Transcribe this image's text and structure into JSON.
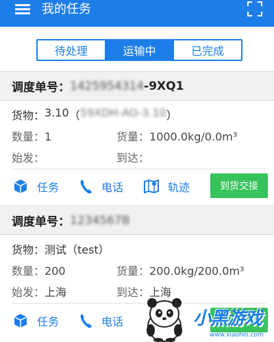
{
  "header": {
    "title": "我的任务",
    "menu_icon": "menu-icon",
    "scan_icon": "scan-icon"
  },
  "tabs": [
    {
      "label": "待处理",
      "active": false
    },
    {
      "label": "运输中",
      "active": true
    },
    {
      "label": "已完成",
      "active": false
    }
  ],
  "colors": {
    "primary": "#1d7ee8",
    "success": "#37c25b"
  },
  "cards": [
    {
      "order_label": "调度单号：",
      "order_number_masked": "1425954314",
      "order_number_suffix": "-9XQ1",
      "goods_label": "货物：",
      "goods_name": "3.10",
      "goods_model_masked": "59XDH-AO-3.10",
      "goods_model_open": "（",
      "goods_model_close": "）",
      "quantity_label": "数量：",
      "quantity": "1",
      "cargo_label": "货量：",
      "cargo": "1000.0kg/0.0m³",
      "origin_label": "始发：",
      "origin": "",
      "dest_label": "到达：",
      "dest": ""
    },
    {
      "order_label": "调度单号：",
      "order_number_masked": "1234567B",
      "goods_label": "货物：",
      "goods_text": "测试（test）",
      "quantity_label": "数量：",
      "quantity": "200",
      "cargo_label": "货量：",
      "cargo": "200.0kg/200.0m³",
      "origin_label": "始发：",
      "origin": "上海",
      "dest_label": "到达：",
      "dest": "上海"
    }
  ],
  "actions": {
    "task_label": "任务",
    "task_icon": "box-icon",
    "phone_label": "电话",
    "phone_icon": "phone-icon",
    "track_label": "轨迹",
    "track_icon": "map-icon",
    "deliver_label": "到货交接"
  },
  "watermark": {
    "name": "小黑游戏",
    "url": "www.xiaohei.com"
  }
}
